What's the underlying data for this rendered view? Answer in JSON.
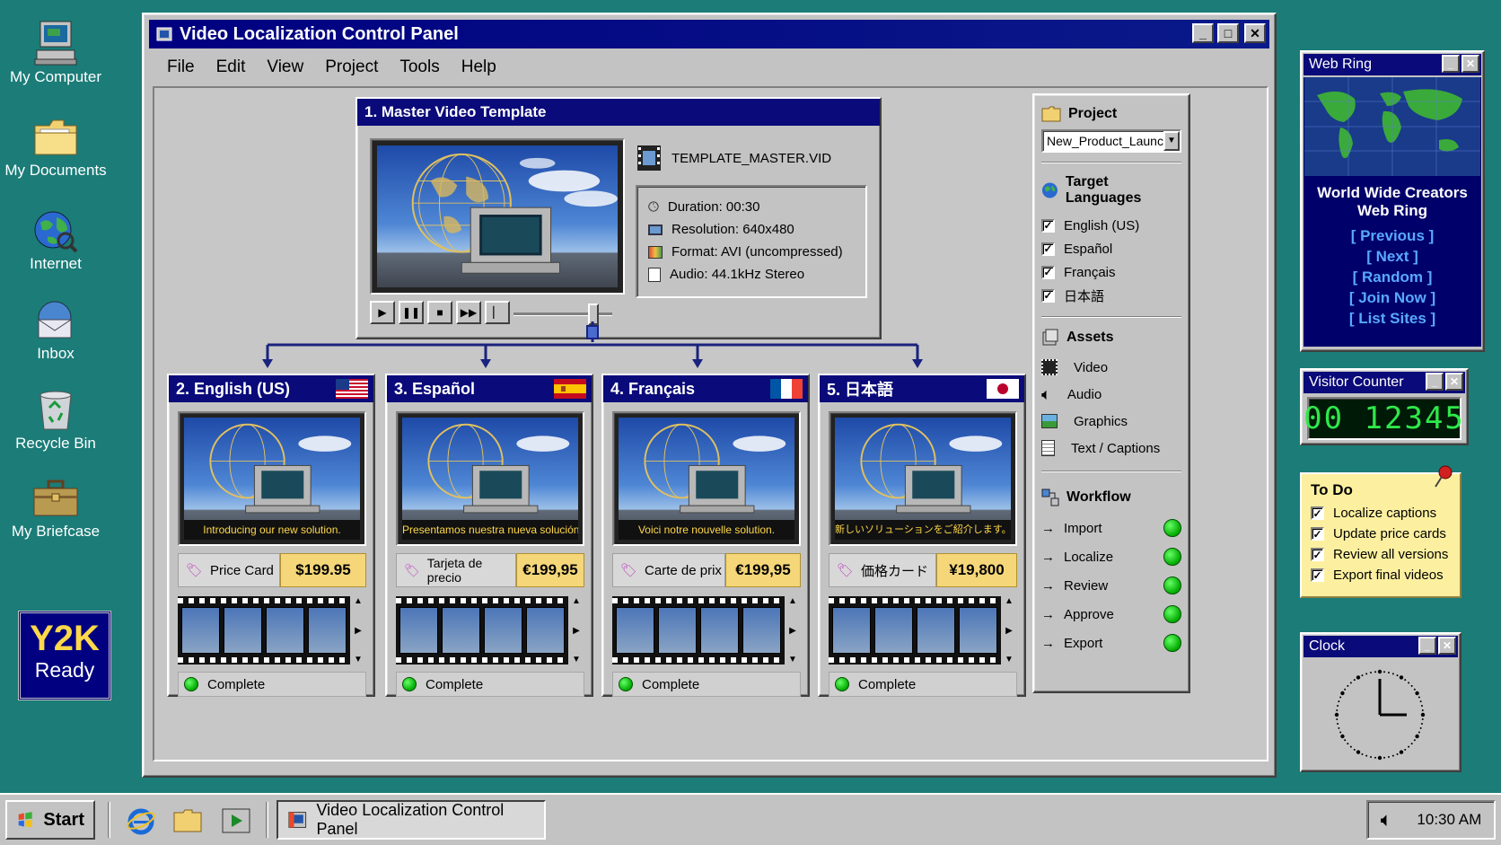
{
  "desktop": {
    "icons": [
      {
        "label": "My Computer",
        "icon": "computer-icon"
      },
      {
        "label": "My Documents",
        "icon": "folder-icon"
      },
      {
        "label": "Internet",
        "icon": "globe-icon"
      },
      {
        "label": "Inbox",
        "icon": "inbox-icon"
      },
      {
        "label": "Recycle Bin",
        "icon": "recycle-bin-icon"
      },
      {
        "label": "My Briefcase",
        "icon": "briefcase-icon"
      }
    ],
    "y2k": {
      "line1": "Y2K",
      "line2": "Ready"
    }
  },
  "window": {
    "title": "Video Localization Control Panel",
    "menu": [
      "File",
      "Edit",
      "View",
      "Project",
      "Tools",
      "Help"
    ]
  },
  "master": {
    "title": "1. Master Video Template",
    "filename": "TEMPLATE_MASTER.VID",
    "duration": "Duration:  00:30",
    "resolution": "Resolution:  640x480",
    "format": "Format:  AVI (uncompressed)",
    "audio": "Audio:  44.1kHz Stereo",
    "playback_position": 0.85
  },
  "languages": [
    {
      "title": "2. English (US)",
      "flag": "us-flag",
      "caption": "Introducing our new solution.",
      "price_label": "Price Card",
      "price": "$199.95",
      "status": "Complete"
    },
    {
      "title": "3. Español",
      "flag": "spain-flag",
      "caption": "Presentamos nuestra nueva solución.",
      "price_label": "Tarjeta de precio",
      "price": "€199,95",
      "status": "Complete"
    },
    {
      "title": "4. Français",
      "flag": "france-flag",
      "caption": "Voici notre nouvelle solution.",
      "price_label": "Carte de prix",
      "price": "€199,95",
      "status": "Complete"
    },
    {
      "title": "5. 日本語",
      "flag": "japan-flag",
      "caption": "新しいソリューションをご紹介します。",
      "price_label": "価格カード",
      "price": "¥19,800",
      "status": "Complete"
    }
  ],
  "sidebar": {
    "project": {
      "heading": "Project",
      "selected": "New_Product_Launch"
    },
    "target_languages": {
      "heading": "Target Languages",
      "items": [
        "English (US)",
        "Español",
        "Français",
        "日本語"
      ]
    },
    "assets": {
      "heading": "Assets",
      "items": [
        "Video",
        "Audio",
        "Graphics",
        "Text / Captions"
      ]
    },
    "workflow": {
      "heading": "Workflow",
      "items": [
        "Import",
        "Localize",
        "Review",
        "Approve",
        "Export"
      ]
    }
  },
  "webring": {
    "title": "Web Ring",
    "name_line1": "World Wide Creators",
    "name_line2": "Web Ring",
    "links": [
      "[ Previous ]",
      "[ Next ]",
      "[ Random ]",
      "[ Join Now ]",
      "[ List Sites ]"
    ]
  },
  "counter": {
    "title": "Visitor Counter",
    "value": "00 12345"
  },
  "todo": {
    "title": "To Do",
    "items": [
      "Localize captions",
      "Update price cards",
      "Review all versions",
      "Export final videos"
    ]
  },
  "clock": {
    "title": "Clock",
    "time_hours": 3,
    "time_minutes": 0
  },
  "taskbar": {
    "start": "Start",
    "task": "Video Localization Control Panel",
    "time": "10:30 AM"
  },
  "colors": {
    "desktop": "#1b7c78",
    "titlebar": "#000080",
    "price_bg": "#f5d77a",
    "complete": "#1fa01f"
  }
}
